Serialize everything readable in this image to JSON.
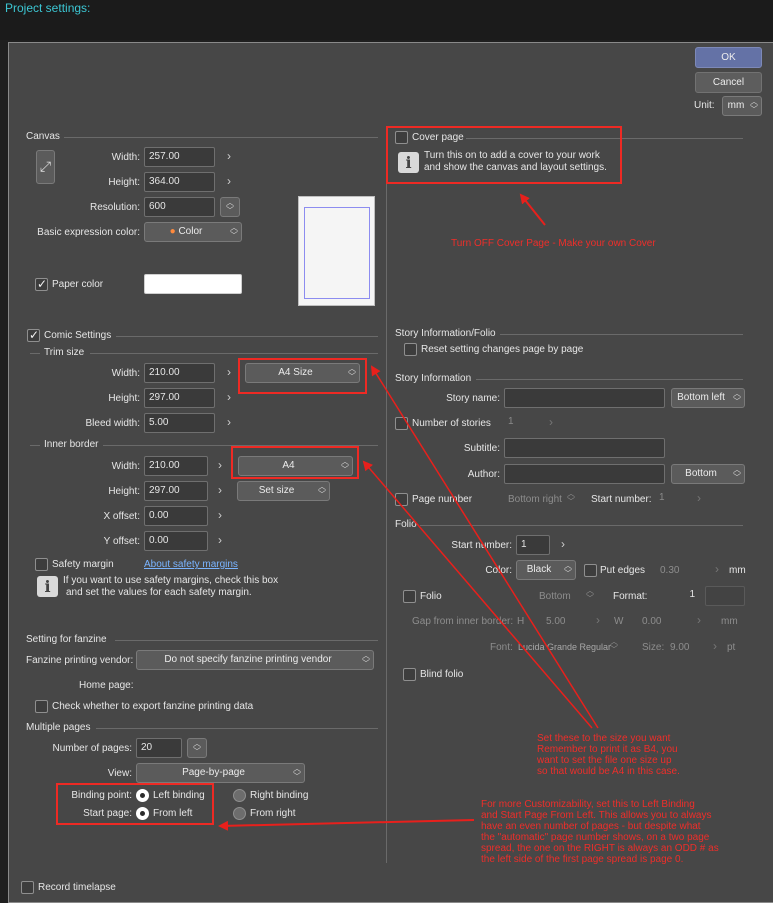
{
  "header": {
    "title": "Project settings:"
  },
  "buttons": {
    "ok": "OK",
    "cancel": "Cancel"
  },
  "unit": {
    "label": "Unit:",
    "value": "mm"
  },
  "canvas": {
    "section": "Canvas",
    "width_label": "Width:",
    "width": "257.00",
    "height_label": "Height:",
    "height": "364.00",
    "resolution_label": "Resolution:",
    "resolution": "600",
    "expression_label": "Basic expression color:",
    "expression": "Color",
    "paper_color_label": "Paper color"
  },
  "comic": {
    "section": "Comic Settings",
    "trim_size": "Trim size",
    "trim_width_label": "Width:",
    "trim_width": "210.00",
    "trim_height_label": "Height:",
    "trim_height": "297.00",
    "preset": "A4 Size",
    "bleed_label": "Bleed width:",
    "bleed": "5.00",
    "inner_border": "Inner border",
    "inner_width_label": "Width:",
    "inner_width": "210.00",
    "inner_height_label": "Height:",
    "inner_height": "297.00",
    "inner_preset": "A4",
    "set_size": "Set size",
    "xoffset_label": "X offset:",
    "xoffset": "0.00",
    "yoffset_label": "Y offset:",
    "yoffset": "0.00",
    "safety_label": "Safety margin",
    "safety_link": "About safety margins",
    "safety_info_1": "If you want to use safety margins, check this box",
    "safety_info_2": "and set the values for each safety margin."
  },
  "fanzine": {
    "section": "Setting for fanzine",
    "vendor_label": "Fanzine printing vendor:",
    "vendor": "Do not specify fanzine printing vendor",
    "home_label": "Home page:",
    "export_label": "Check whether to export fanzine printing data"
  },
  "multiple": {
    "section": "Multiple pages",
    "pages_label": "Number of pages:",
    "pages": "20",
    "view_label": "View:",
    "view": "Page-by-page",
    "binding_label": "Binding point:",
    "left_binding": "Left binding",
    "right_binding": "Right binding",
    "start_label": "Start page:",
    "from_left": "From left",
    "from_right": "From right"
  },
  "record": "Record timelapse",
  "cover": {
    "label": "Cover page",
    "info_1": "Turn this on to add a cover to your work",
    "info_2": "and show the canvas and layout settings."
  },
  "story_folio": {
    "section": "Story Information/Folio",
    "reset_label": "Reset setting changes page by page"
  },
  "story": {
    "section": "Story Information",
    "name_label": "Story name:",
    "name_pos": "Bottom left",
    "stories_label": "Number of stories",
    "stories": "1",
    "subtitle_label": "Subtitle:",
    "author_label": "Author:",
    "author_pos": "Bottom",
    "page_number_label": "Page number",
    "page_number_pos": "Bottom right",
    "start_number_label": "Start number:",
    "start_number": "1"
  },
  "folio": {
    "section": "Folio",
    "start_label": "Start number:",
    "start": "1",
    "color_label": "Color:",
    "color": "Black",
    "edges_label": "Put edges",
    "edges": "0.30",
    "edges_unit": "mm",
    "folio_label": "Folio",
    "folio_pos": "Bottom",
    "format_label": "Format:",
    "format": "1",
    "gap_label": "Gap from inner border:",
    "gap_h_label": "H",
    "gap_h": "5.00",
    "gap_w_label": "W",
    "gap_w": "0.00",
    "gap_unit": "mm",
    "font_label": "Font:",
    "font": "Lucida Grande Regular",
    "size_label": "Size:",
    "size": "9.00",
    "size_unit": "pt",
    "blind_label": "Blind folio"
  },
  "annotations": {
    "cover_note": "Turn OFF Cover Page - Make your own Cover",
    "size_note_1": "Set these to the size you want",
    "size_note_2": "Remember to print it as B4, you",
    "size_note_3": "want to set the file one size up",
    "size_note_4": "so that would be A4 in this case.",
    "bind_note_1": "For more Customizability, set this to Left Binding",
    "bind_note_2": "and Start Page From Left. This allows you to always",
    "bind_note_3": "have an even number of pages - but despite what",
    "bind_note_4": "the \"automatic\" page number shows, on a two page",
    "bind_note_5": "spread, the one on the RIGHT is always an ODD # as",
    "bind_note_6": "the left side of the first page spread is page 0."
  },
  "colors": {
    "accent": "#3cc6d3",
    "annotation": "#ef2e2a",
    "ok": "#6472a6"
  }
}
